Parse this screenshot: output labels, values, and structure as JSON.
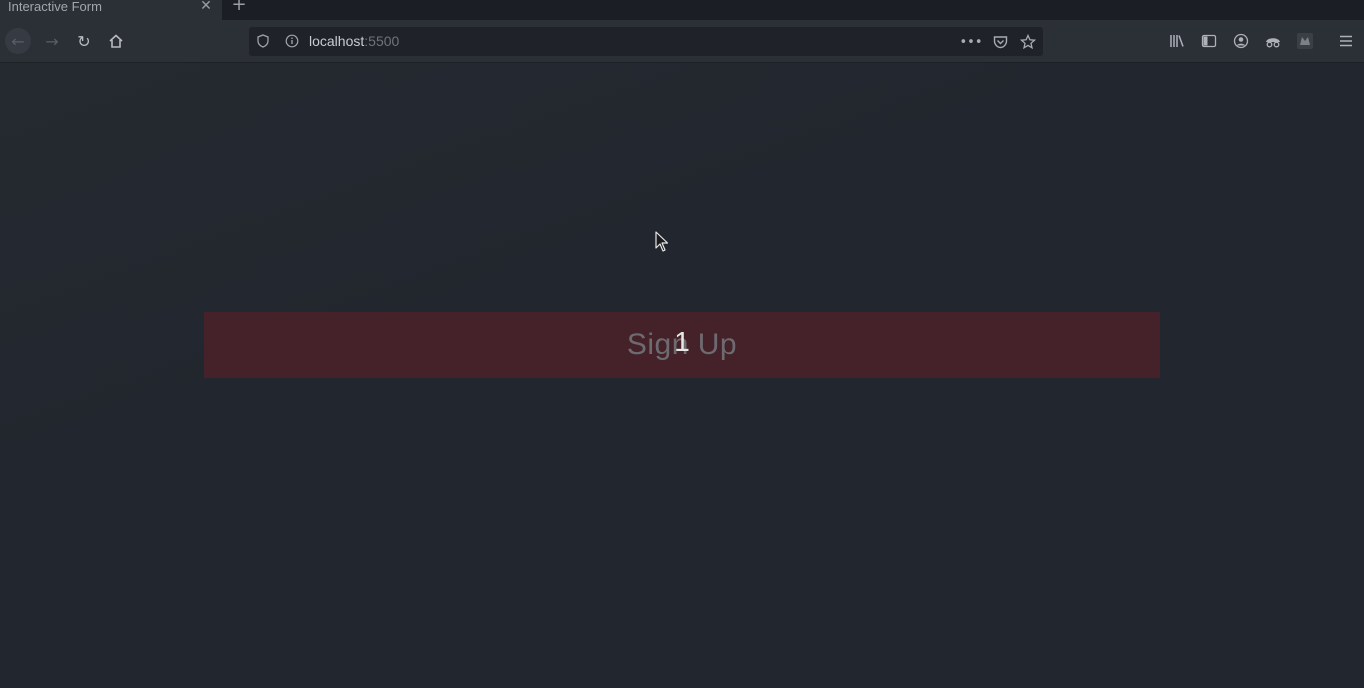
{
  "browser": {
    "tab": {
      "title": "Interactive Form",
      "close_icon": "close-icon"
    },
    "new_tab_icon": "plus-icon",
    "toolbar": {
      "back_icon": "arrow-left-icon",
      "forward_icon": "arrow-right-icon",
      "reload_icon": "reload-icon",
      "home_icon": "home-icon",
      "url": {
        "host": "localhost",
        "port": ":5500",
        "shield_icon": "shield-icon",
        "info_icon": "info-icon",
        "more_icon": "ellipsis-icon",
        "pocket_icon": "pocket-icon",
        "bookmark_icon": "star-icon"
      },
      "right_icons": [
        "library-icon",
        "sidebar-icon",
        "account-icon",
        "incognito-icon",
        "extension-icon",
        "hamburger-menu-icon"
      ]
    }
  },
  "page": {
    "signup_button_label": "Sign Up",
    "overlay_counter": "1"
  },
  "colors": {
    "page_background": "#22262e",
    "button_background": "#452129",
    "button_text": "#6d6b70"
  }
}
